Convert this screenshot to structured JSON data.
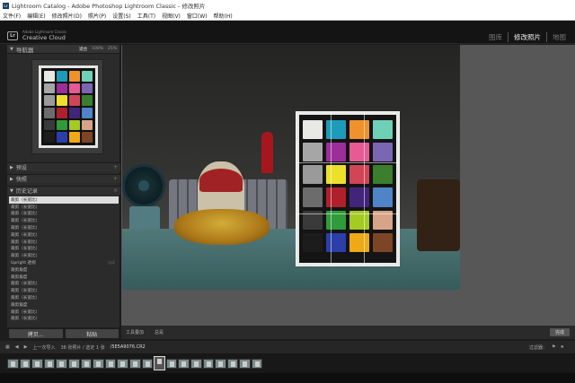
{
  "window": {
    "title": "Lightroom Catalog - Adobe Photoshop Lightroom Classic - 修改照片",
    "app_badge": "Lr"
  },
  "menu": [
    "文件(F)",
    "编辑(E)",
    "修改照片(D)",
    "照片(P)",
    "设置(S)",
    "工具(T)",
    "视图(V)",
    "窗口(W)",
    "帮助(H)"
  ],
  "identity": {
    "badge": "Lr",
    "brand_small": "Adobe Lightroom Classic",
    "brand_large": "Creative Cloud"
  },
  "modules": [
    "图库",
    "修改照片",
    "地图"
  ],
  "navigator": {
    "label": "导航器",
    "zoom": [
      "适合",
      "100%",
      "25%"
    ]
  },
  "panels": {
    "presets": "预设",
    "snapshots": "快照",
    "history": "历史记录"
  },
  "history": [
    {
      "label": "裁剪（长宽比）",
      "selected": true,
      "v1": "",
      "v2": ""
    },
    {
      "label": "裁剪（长宽比）",
      "v1": "",
      "v2": ""
    },
    {
      "label": "裁剪（长宽比）",
      "v1": "",
      "v2": ""
    },
    {
      "label": "裁剪（长宽比）",
      "v1": "",
      "v2": ""
    },
    {
      "label": "裁剪（长宽比）",
      "v1": "",
      "v2": ""
    },
    {
      "label": "裁剪（长宽比）",
      "v1": "",
      "v2": ""
    },
    {
      "label": "裁剪（长宽比）",
      "v1": "",
      "v2": ""
    },
    {
      "label": "裁剪（长宽比）",
      "v1": "",
      "v2": ""
    },
    {
      "label": "裁剪（长宽比）",
      "v1": "",
      "v2": ""
    },
    {
      "label": "Upright 透视",
      "v1": "",
      "v2": "自动"
    },
    {
      "label": "裁剪角度",
      "v1": "",
      "v2": ""
    },
    {
      "label": "裁剪角度",
      "v1": "",
      "v2": ""
    },
    {
      "label": "裁剪（长宽比）",
      "v1": "",
      "v2": ""
    },
    {
      "label": "裁剪（长宽比）",
      "v1": "",
      "v2": ""
    },
    {
      "label": "裁剪（长宽比）",
      "v1": "",
      "v2": ""
    },
    {
      "label": "裁剪角度",
      "v1": "",
      "v2": ""
    },
    {
      "label": "裁剪（长宽比）",
      "v1": "",
      "v2": ""
    },
    {
      "label": "裁剪（长宽比）",
      "v1": "",
      "v2": ""
    }
  ],
  "left_buttons": {
    "copy": "拷贝...",
    "paste": "粘贴"
  },
  "toolbar": {
    "tool_overlay": "工具叠加",
    "grid": "总是",
    "done": "完成"
  },
  "filmstrip": {
    "prev_import": "上一次导入",
    "count": "38 张照片 / 选定 1 张",
    "file": "/5E5A9076.CR2",
    "filter": "过滤器："
  },
  "colors": {
    "card": [
      "#e8e8e4",
      "#1e9bb8",
      "#f0922c",
      "#6fd0b8",
      "#a6a6a6",
      "#9b2e9a",
      "#e85a95",
      "#7b66b4",
      "#9a9a9a",
      "#ece02a",
      "#d14556",
      "#3b7e2d",
      "#6c6c6c",
      "#b0202c",
      "#42257a",
      "#4f84c8",
      "#3a3a3a",
      "#2f9b3a",
      "#a4ca24",
      "#d6a487",
      "#1c1c1c",
      "#2c3eaa",
      "#f0a916",
      "#7c4626"
    ]
  }
}
